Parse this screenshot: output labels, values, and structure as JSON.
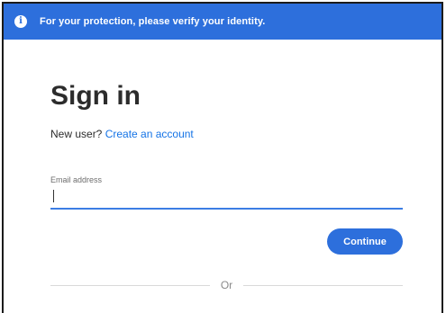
{
  "banner": {
    "icon": "info-icon",
    "message": "For your protection, please verify your identity."
  },
  "signin": {
    "title": "Sign in",
    "new_user_prompt": "New user?",
    "create_account_link": "Create an account",
    "email_label": "Email address",
    "email_value": "",
    "continue_label": "Continue",
    "divider_text": "Or"
  },
  "colors": {
    "accent": "#2d6fdc",
    "link": "#1473e6",
    "title": "#2c2c2c"
  }
}
